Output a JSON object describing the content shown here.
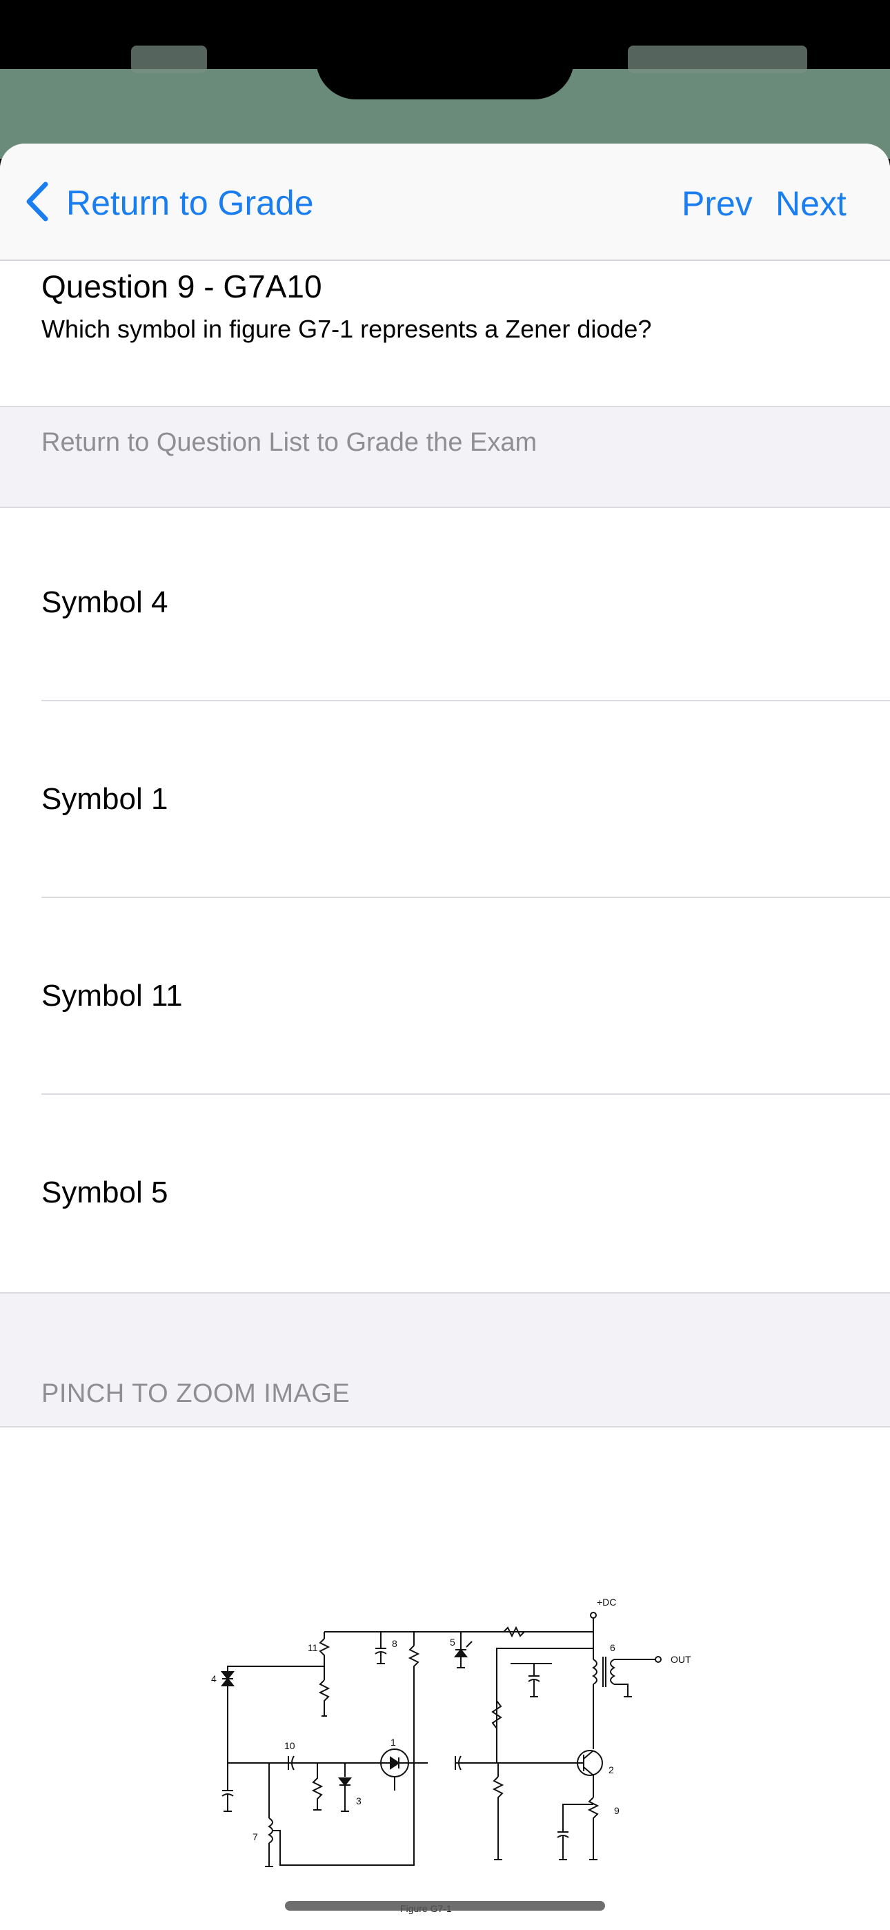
{
  "nav": {
    "back_label": "Return to Grade",
    "prev_label": "Prev",
    "next_label": "Next"
  },
  "question": {
    "title": "Question 9 - G7A10",
    "text": "Which symbol in figure G7-1 represents a Zener diode?"
  },
  "grade_banner": "Return to Question List to Grade the Exam",
  "answers": [
    {
      "label": "Symbol 4"
    },
    {
      "label": "Symbol 1"
    },
    {
      "label": "Symbol 11"
    },
    {
      "label": "Symbol 5"
    }
  ],
  "zoom_header": "PINCH TO ZOOM IMAGE",
  "figure": {
    "caption": "Figure G7-1",
    "dc_label": "+DC",
    "out_label": "OUT",
    "component_numbers": [
      "1",
      "2",
      "3",
      "4",
      "5",
      "6",
      "7",
      "8",
      "9",
      "10",
      "11"
    ]
  },
  "colors": {
    "accent": "#1a7ef0",
    "secondary_text": "#8e8e93",
    "grouped_background": "#f2f2f7"
  }
}
